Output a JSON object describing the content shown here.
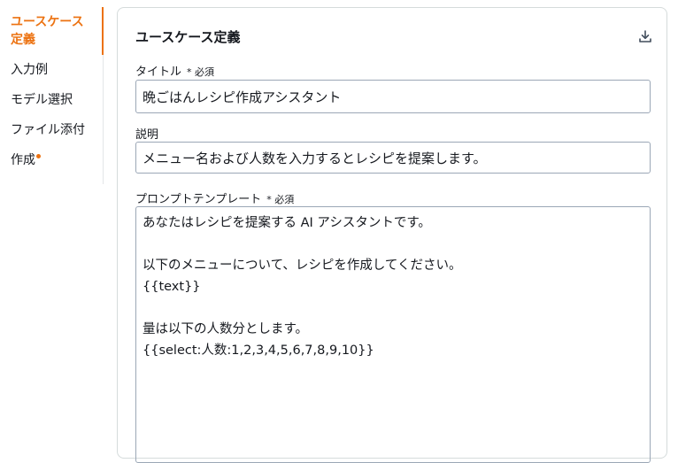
{
  "nav": {
    "items": [
      {
        "label": "ユースケース定義",
        "active": true
      },
      {
        "label": "入力例"
      },
      {
        "label": "モデル選択"
      },
      {
        "label": "ファイル添付"
      },
      {
        "label": "作成"
      }
    ]
  },
  "card": {
    "title": "ユースケース定義",
    "download_icon": "download-icon",
    "fields": {
      "title": {
        "label": "タイトル",
        "required": "* 必須",
        "value": "晩ごはんレシピ作成アシスタント"
      },
      "description": {
        "label": "説明",
        "value": "メニュー名および人数を入力するとレシピを提案します。"
      },
      "prompt": {
        "label": "プロンプトテンプレート",
        "required": "* 必須",
        "value": "あなたはレシピを提案する AI アシスタントです。\n\n以下のメニューについて、レシピを作成してください。\n{{text}}\n\n量は以下の人数分とします。\n{{select:人数:1,2,3,4,5,6,7,8,9,10}}"
      }
    }
  },
  "colors": {
    "accent": "#ec7211",
    "border": "#9ba7b6"
  }
}
